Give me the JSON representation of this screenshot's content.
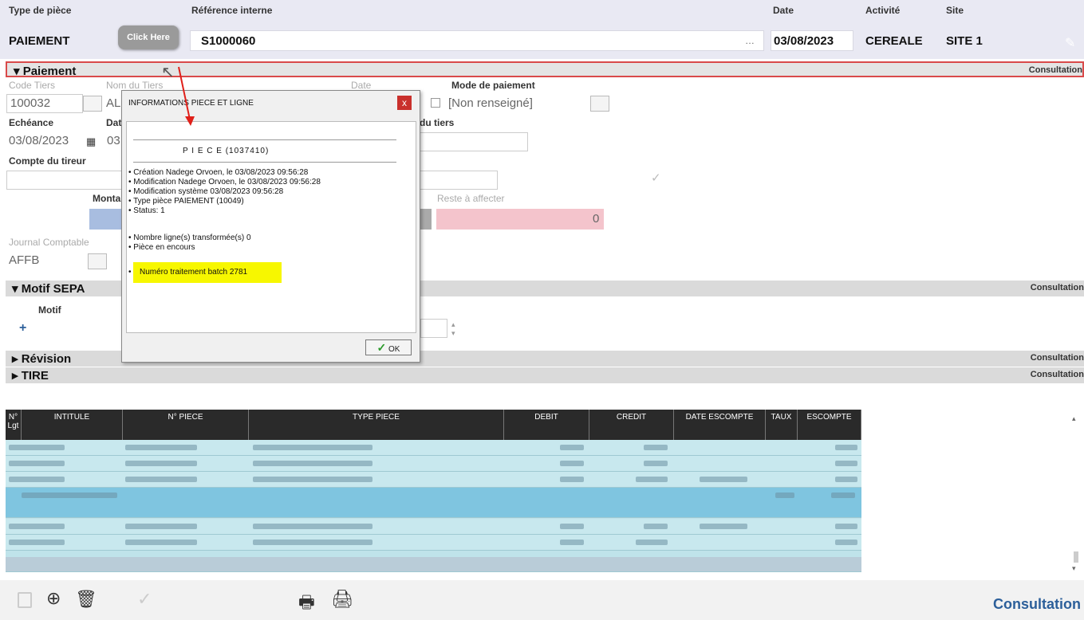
{
  "header": {
    "type_piece_label": "Type de pièce",
    "type_piece_value": "PAIEMENT",
    "ref_interne_label": "Référence interne",
    "ref_interne_value": "S1000060",
    "date_label": "Date",
    "date_value": "03/08/2023",
    "activite_label": "Activité",
    "activite_value": "CEREALE",
    "site_label": "Site",
    "site_value": "SITE 1"
  },
  "tooltip": {
    "text": "Click Here"
  },
  "sections": {
    "paiement": "▾ Paiement",
    "motif_sepa": "▾ Motif SEPA",
    "revision": "▸ Révision",
    "tire": "▸ TIRE",
    "consultation": "Consultation"
  },
  "paiement_form": {
    "code_tiers_label": "Code Tiers",
    "code_tiers_value": "100032",
    "nom_tiers_label": "Nom du Tiers",
    "nom_tiers_value": "AL",
    "date_label": "Date",
    "mode_paiement_label": "Mode de paiement",
    "mode_paiement_value": "[Non renseigné]",
    "echeance_label": "Echéance",
    "echeance_value": "03/08/2023",
    "dat_label": "Dat",
    "dat_value": "03",
    "du_tiers_label": "du tiers",
    "compte_tireur_label": "Compte du tireur",
    "montant_label": "Monta",
    "reste_label": "Reste à affecter",
    "reste_value": "0",
    "journal_label": "Journal Comptable",
    "journal_value": "AFFB",
    "motif_label": "Motif",
    "plus": "+"
  },
  "dialog": {
    "title": "INFORMATIONS PIECE ET LIGNE",
    "close": "x",
    "piece": "P I E C E  (1037410)",
    "creation": "•  Création       Nadege Orvoen,  le 03/08/2023 09:56:28",
    "modification": "•  Modification Nadege Orvoen,  le 03/08/2023 09:56:28",
    "modif_systeme": "•  Modification système 03/08/2023 09:56:28",
    "type_piece": "•  Type pièce    PAIEMENT  (10049)",
    "status": "•  Status: 1",
    "nb_lignes": "•  Nombre ligne(s) transformée(s)   0",
    "encours": "•  Pièce en encours",
    "batch": "Numéro traitement batch  2781",
    "ok": "OK"
  },
  "table": {
    "columns": [
      "N° Lgt",
      "INTITULE",
      "N° PIECE",
      "TYPE PIECE",
      "DEBIT",
      "CREDIT",
      "DATE ESCOMPTE",
      "TAUX",
      "ESCOMPTE"
    ]
  },
  "footer": {
    "consultation": "Consultation"
  },
  "colors": {
    "highlight": "#f7f700",
    "active_border": "#d94a4a",
    "reste_bg": "#f4c4cc",
    "link": "#2c5f9a"
  }
}
